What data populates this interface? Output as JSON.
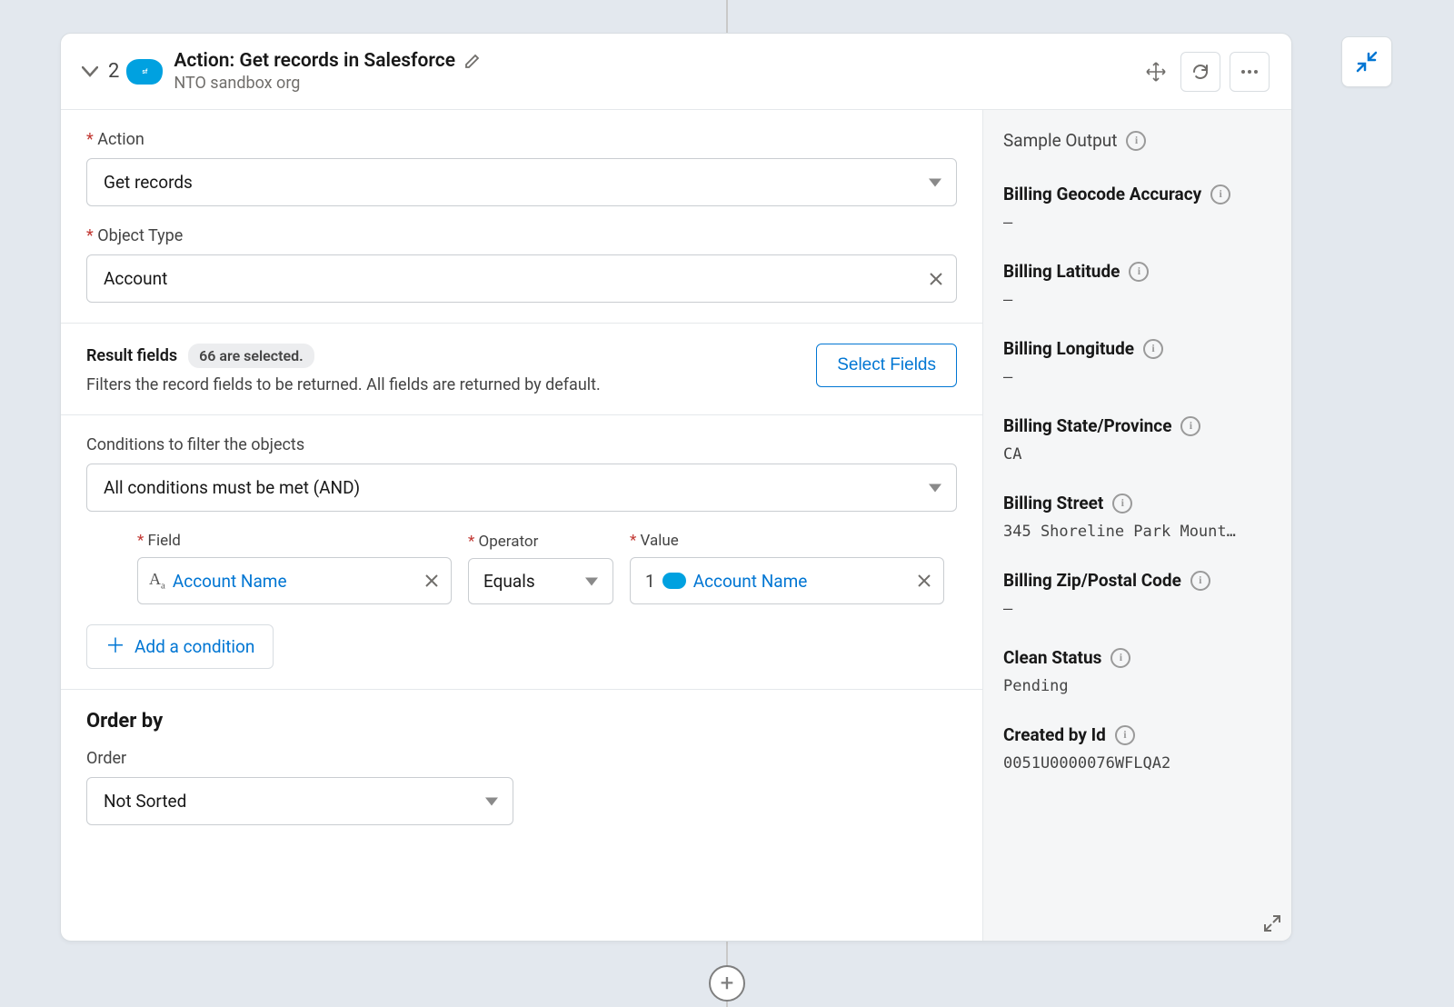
{
  "header": {
    "step_number": "2",
    "title": "Action: Get records in Salesforce",
    "subtitle": "NTO sandbox org"
  },
  "form": {
    "action_label": "Action",
    "action_value": "Get records",
    "object_type_label": "Object Type",
    "object_type_value": "Account",
    "result_fields_title": "Result fields",
    "result_fields_badge": "66 are selected.",
    "result_fields_desc": "Filters the record fields to be returned. All fields are returned by default.",
    "select_fields_btn": "Select Fields",
    "conditions_label": "Conditions to filter the objects",
    "conditions_value": "All conditions must be met (AND)",
    "cond_field_label": "Field",
    "cond_field_value": "Account Name",
    "cond_operator_label": "Operator",
    "cond_operator_value": "Equals",
    "cond_value_label": "Value",
    "cond_value_step": "1",
    "cond_value_text": "Account Name",
    "add_condition_btn": "Add a condition",
    "order_by_title": "Order by",
    "order_label": "Order",
    "order_value": "Not Sorted"
  },
  "sample": {
    "title": "Sample Output",
    "fields": [
      {
        "name": "Billing Geocode Accuracy",
        "value": "–"
      },
      {
        "name": "Billing Latitude",
        "value": "–"
      },
      {
        "name": "Billing Longitude",
        "value": "–"
      },
      {
        "name": "Billing State/Province",
        "value": "CA"
      },
      {
        "name": "Billing Street",
        "value": "345 Shoreline Park Mount…"
      },
      {
        "name": "Billing Zip/Postal Code",
        "value": "–"
      },
      {
        "name": "Clean Status",
        "value": "Pending"
      },
      {
        "name": "Created by Id",
        "value": "0051U0000076WFLQA2"
      }
    ]
  }
}
